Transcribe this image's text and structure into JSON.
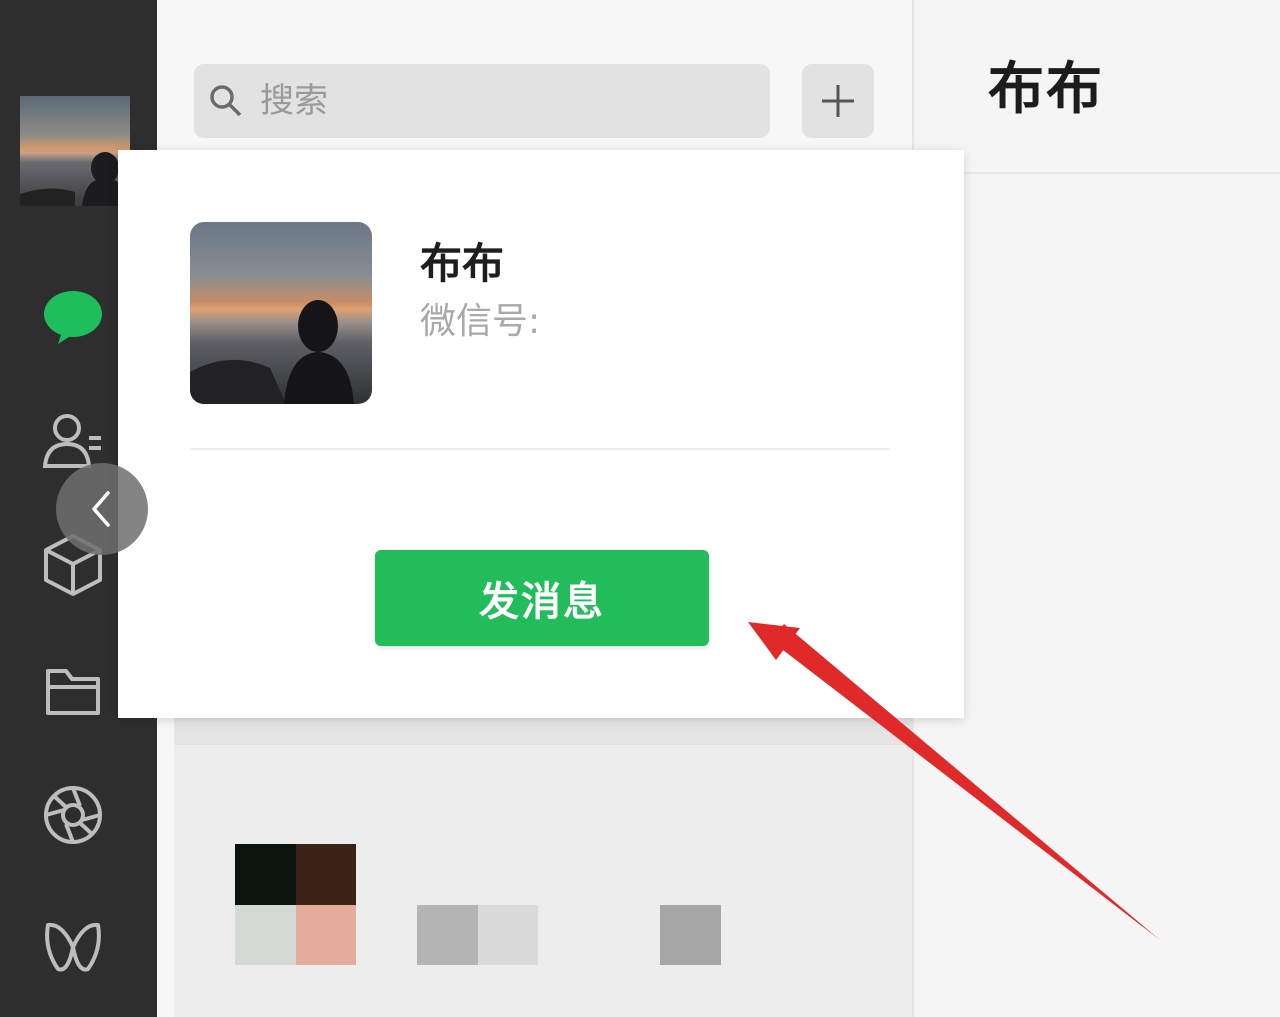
{
  "search": {
    "placeholder": "搜索"
  },
  "header": {
    "chat_title": "布布"
  },
  "profile_card": {
    "name": "布布",
    "wechat_id_label": "微信号:",
    "send_message_label": "发消息"
  },
  "sidebar": {
    "items": [
      {
        "icon": "avatar"
      },
      {
        "icon": "chat-icon",
        "active": true
      },
      {
        "icon": "contacts-icon"
      },
      {
        "icon": "box-icon"
      },
      {
        "icon": "folder-icon"
      },
      {
        "icon": "moments-icon"
      },
      {
        "icon": "channels-icon"
      }
    ]
  },
  "colors": {
    "accent_green": "#22bd5a",
    "sidebar_bg": "#2e2e2e",
    "annotation_red": "#e02a2a"
  }
}
